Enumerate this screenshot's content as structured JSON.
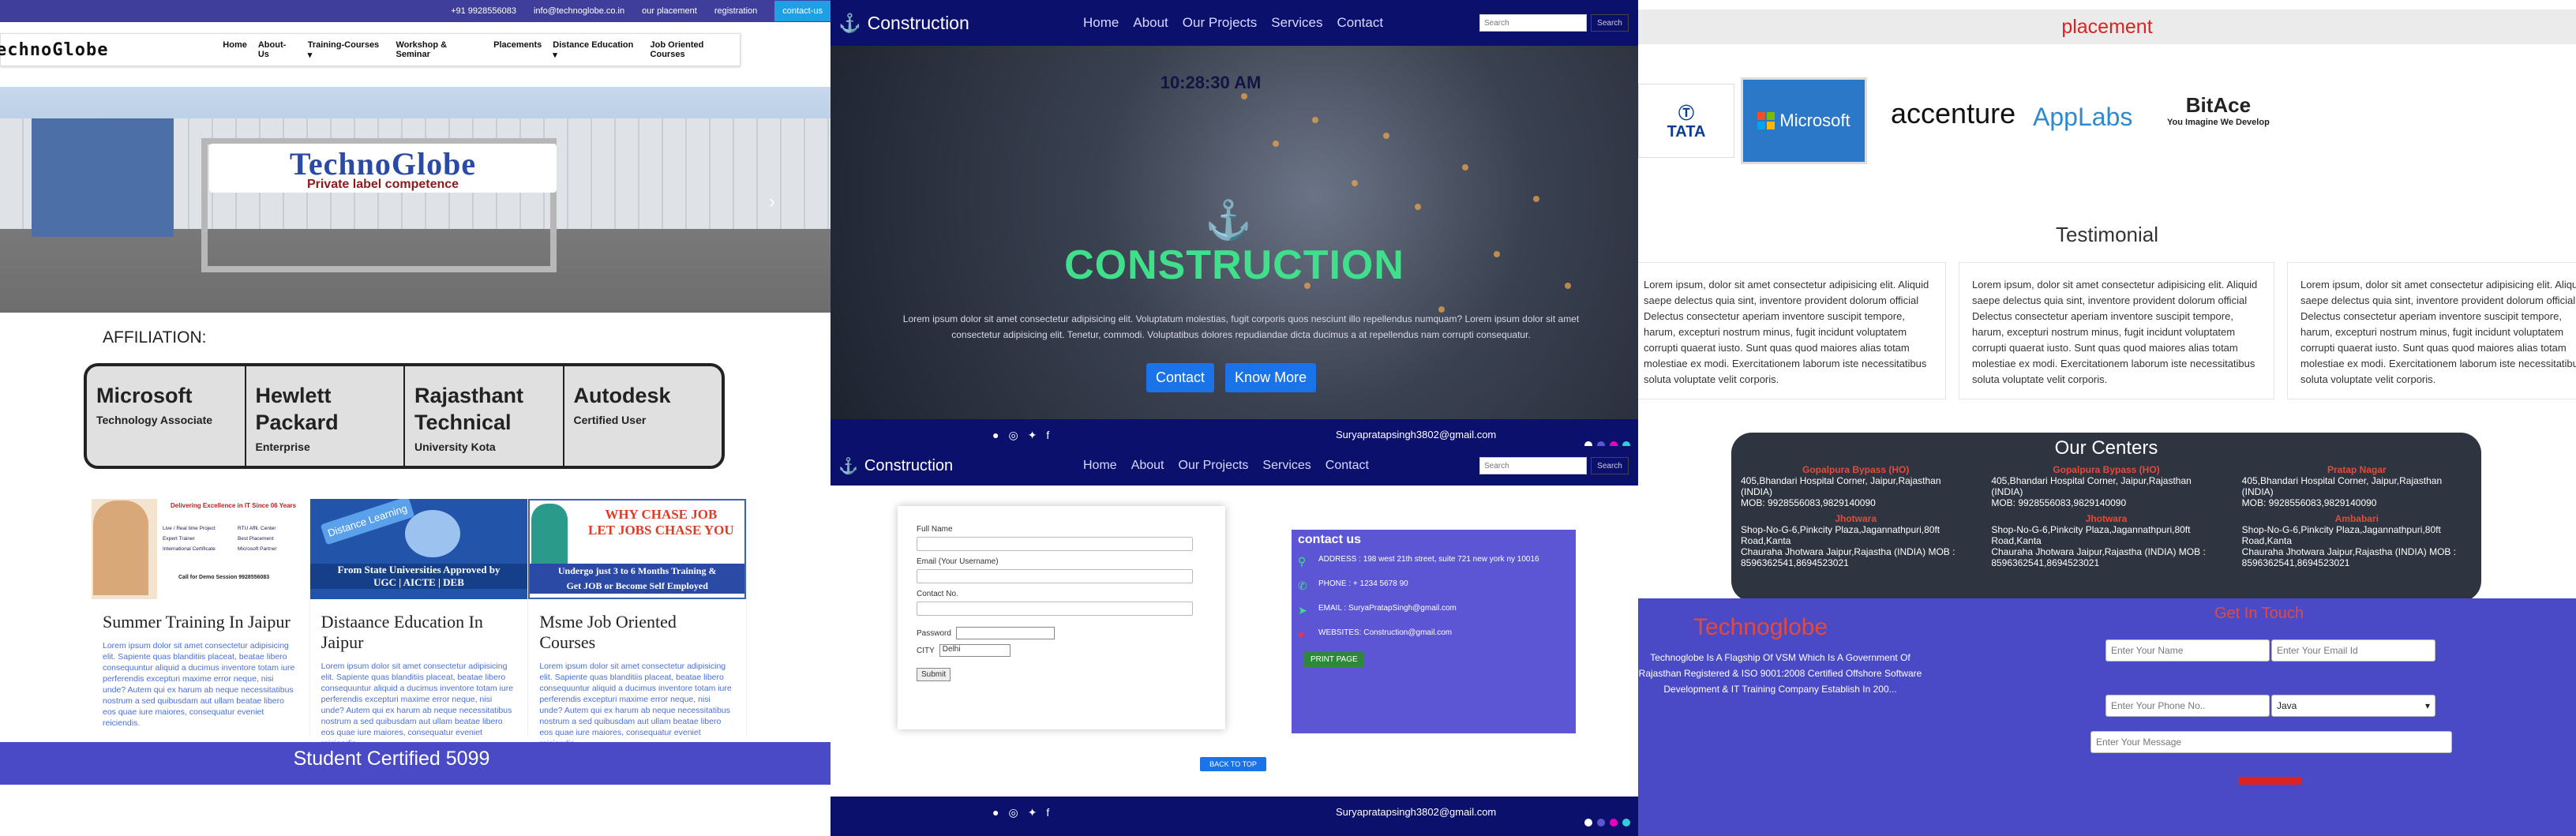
{
  "p1": {
    "topbar": {
      "phone": "+91 9928556083",
      "email": "info@technoglobe.co.in",
      "placement": "our placement",
      "registration": "registration",
      "contact": "contact-us"
    },
    "logo": "echnoGlobe",
    "menu": [
      "Home",
      "About-Us",
      "Training-Courses ▾",
      "Workshop & Seminar",
      "Placements",
      "Distance Education ▾",
      "Job Oriented Courses"
    ],
    "sign_title": "TechnoGlobe",
    "sign_sub": "Private label competence",
    "affiliation": "AFFILIATION:",
    "affiliates": [
      {
        "name": "Microsoft",
        "desc": "Technology Associate"
      },
      {
        "name": "Hewlett Packard",
        "desc": "Enterprise"
      },
      {
        "name": "Rajasthant Technical",
        "desc": "University Kota"
      },
      {
        "name": "Autodesk",
        "desc": "Certified User"
      }
    ],
    "banner1": {
      "title": "Delivering Excellence in IT Since 06 Years",
      "items": [
        "Live / Real time Project",
        "RTU Affil. Center",
        "Expert Trainer",
        "Best Placement",
        "International Certificate",
        "Microsoft Partner"
      ],
      "call": "Call for Demo Session 9928556083"
    },
    "banner2": {
      "logo": "Distance Learning",
      "line1": "From State Universities Approved by",
      "line2": "UGC | AICTE | DEB"
    },
    "banner3": {
      "line1": "WHY CHASE JOB",
      "line2": "LET JOBS CHASE YOU",
      "line3": "Undergo just 3 to 6 Months Training &",
      "line4": "Get JOB or Become Self Employed"
    },
    "cards": [
      {
        "title": "Summer Training In Jaipur",
        "text": "Lorem ipsum dolor sit amet consectetur adipisicing elit. Sapiente quas blanditiis placeat, beatae libero consequuntur aliquid a ducimus inventore totam iure perferendis excepturi maxime error neque, nisi unde? Autem qui ex harum ab neque necessitatibus nostrum a sed quibusdam aut ullam beatae libero eos quae iure maiores, consequatur eveniet reiciendis."
      },
      {
        "title": "Distaance Education In Jaipur",
        "text": "Lorem ipsum dolor sit amet consectetur adipisicing elit. Sapiente quas blanditiis placeat, beatae libero consequuntur aliquid a ducimus inventore totam iure perferendis excepturi maxime error neque, nisi unde? Autem qui ex harum ab neque necessitatibus nostrum a sed quibusdam aut ullam beatae libero eos quae iure maiores, consequatur eveniet reiciendis."
      },
      {
        "title": "Msme Job Oriented Courses",
        "text": "Lorem ipsum dolor sit amet consectetur adipisicing elit. Sapiente quas blanditiis placeat, beatae libero consequuntur aliquid a ducimus inventore totam iure perferendis excepturi maxime error neque, nisi unde? Autem qui ex harum ab neque necessitatibus nostrum a sed quibusdam aut ullam beatae libero eos quae iure maiores, consequatur eveniet reiciendis."
      }
    ],
    "footer": "Student Certified 5099"
  },
  "p2": {
    "brand": "Construction",
    "menu": [
      "Home",
      "About",
      "Our Projects",
      "Services",
      "Contact"
    ],
    "search_placeholder": "Search",
    "search_btn": "Search",
    "clock": "10:28:30 AM",
    "hero_title": "CONSTRUCTION",
    "hero_text": "Lorem ipsum dolor sit amet consectetur adipisicing elit. Voluptatum molestias, fugit corporis quos nesciunt illo repellendus numquam? Lorem ipsum dolor sit amet consectetur adipisicing elit. Tenetur, commodi. Voluptatibus dolores repudiandae dicta ducimus a at repellendus nam corrupti consequatur.",
    "btn_contact": "Contact",
    "btn_know": "Know More",
    "email": "Suryapratapsingh3802@gmail.com",
    "form": {
      "full_name": "Full Name",
      "email": "Email (Your Username)",
      "contact": "Contact No.",
      "password": "Password",
      "city": "CITY",
      "city_value": "Delhi",
      "submit": "Submit"
    },
    "contact_box": {
      "title": "contact us",
      "address_label": "ADDRESS :",
      "address": "198 west 21th street, suite 721 new york ny 10016",
      "phone_label": "PHONE :",
      "phone": "+ 1234 5678 90",
      "email_label": "EMAIL :",
      "email": "SuryaPratapSingh@gmail.com",
      "web_label": "WEBSITES:",
      "web": "Construction@gmail.com",
      "print": "PRINT PAGE"
    },
    "bottom_btn": "BACK TO TOP",
    "footer_email": "Suryapratapsingh3802@gmail.com"
  },
  "p3": {
    "placement": "placement",
    "logos": {
      "tata": "TATA",
      "ms": "Microsoft",
      "acc": "accenture",
      "apl": "AppLabs",
      "bit": "BitAce",
      "bit_sub": "You Imagine We Develop"
    },
    "testimonial": "Testimonial",
    "tcards": [
      "Lorem ipsum, dolor sit amet consectetur adipisicing elit. Aliquid saepe delectus quia sint, inventore provident dolorum official Delectus consectetur aperiam inventore suscipit tempore, harum, excepturi nostrum minus, fugit incidunt voluptatem corrupti quaerat iusto. Sunt quas quod maiores alias totam molestiae ex modi. Exercitationem laborum iste necessitatibus soluta voluptate velit corporis.",
      "Lorem ipsum, dolor sit amet consectetur adipisicing elit. Aliquid saepe delectus quia sint, inventore provident dolorum official Delectus consectetur aperiam inventore suscipit tempore, harum, excepturi nostrum minus, fugit incidunt voluptatem corrupti quaerat iusto. Sunt quas quod maiores alias totam molestiae ex modi. Exercitationem laborum iste necessitatibus soluta voluptate velit corporis.",
      "Lorem ipsum, dolor sit amet consectetur adipisicing elit. Aliquid saepe delectus quia sint, inventore provident dolorum official Delectus consectetur aperiam inventore suscipit tempore, harum, excepturi nostrum minus, fugit incidunt voluptatem corrupti quaerat iusto. Sunt quas quod maiores alias totam molestiae ex modi. Exercitationem laborum iste necessitatibus soluta voluptate velit corporis."
    ],
    "centers_title": "Our Centers",
    "centers": [
      {
        "h": "Gopalpura Bypass (HO)",
        "t": "405,Bhandari Hospital Corner, Jaipur,Rajasthan (INDIA)\nMOB: 9928556083,9829140090"
      },
      {
        "h": "Gopalpura Bypass (HO)",
        "t": "405,Bhandari Hospital Corner, Jaipur,Rajasthan (INDIA)\nMOB: 9928556083,9829140090"
      },
      {
        "h": "Pratap Nagar",
        "t": "405,Bhandari Hospital Corner, Jaipur,Rajasthan (INDIA)\nMOB: 9928556083,9829140090"
      },
      {
        "h": "Jhotwara",
        "t": "Shop-No-G-6,Pinkcity Plaza,Jagannathpuri,80ft Road,Kanta\nChauraha Jhotwara Jaipur,Rajastha (INDIA) MOB : 8596362541,8694523021"
      },
      {
        "h": "Jhotwara",
        "t": "Shop-No-G-6,Pinkcity Plaza,Jagannathpuri,80ft Road,Kanta\nChauraha Jhotwara Jaipur,Rajastha (INDIA) MOB : 8596362541,8694523021"
      },
      {
        "h": "Ambabari",
        "t": "Shop-No-G-6,Pinkcity Plaza,Jagannathpuri,80ft Road,Kanta\nChauraha Jhotwara Jaipur,Rajastha (INDIA) MOB : 8596362541,8694523021"
      }
    ],
    "footer_brand": "Technoglobe",
    "footer_desc": "Technoglobe Is A Flagship Of VSM Which Is A Government Of Rajasthan Registered & ISO 9001:2008 Certified Offshore Software Development & IT Training Company Establish In 200...",
    "git": "Get In Touch",
    "ph_name": "Enter Your Name",
    "ph_email": "Enter Your Email Id",
    "ph_phone": "Enter Your Phone No..",
    "course": "Java",
    "ph_msg": "Enter Your Message"
  }
}
